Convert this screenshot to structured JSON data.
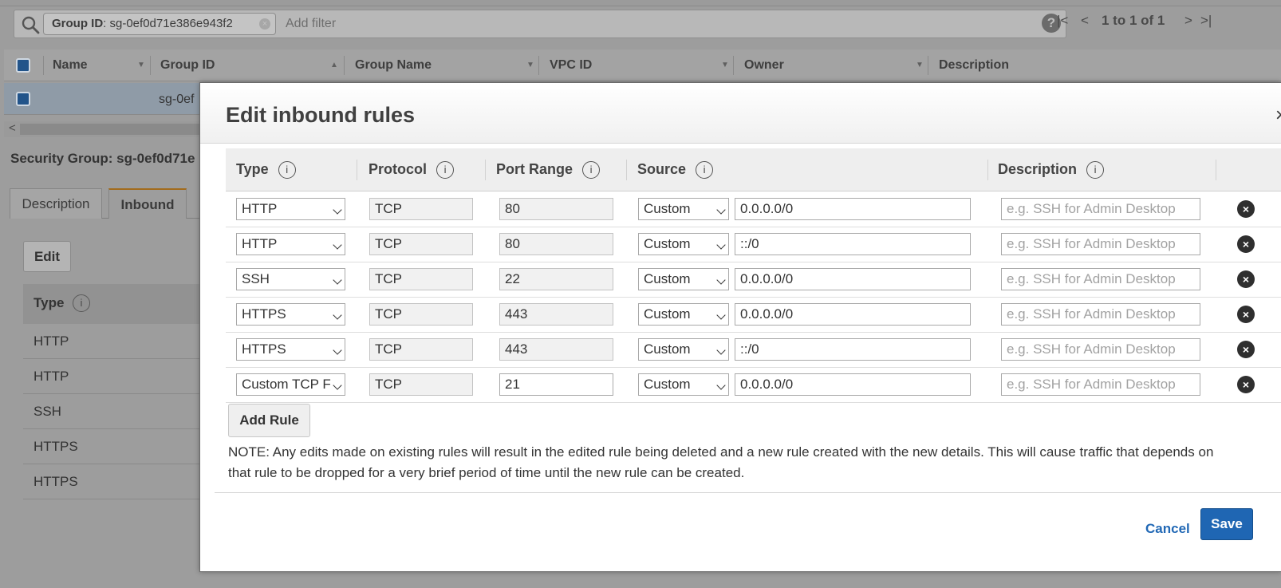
{
  "filter": {
    "chip_key": "Group ID",
    "chip_value": ": sg-0ef0d71e386e943f2",
    "placeholder": "Add filter",
    "help_glyph": "?",
    "pagination": "1 to 1 of 1",
    "first_glyph": "|<",
    "prev_glyph": "<",
    "next_glyph": ">",
    "last_glyph": ">|"
  },
  "grid": {
    "columns": [
      "Name",
      "Group ID",
      "Group Name",
      "VPC ID",
      "Owner",
      "Description"
    ],
    "row_group_id": "sg-0ef",
    "scroll_left": "<"
  },
  "detail": {
    "title": "Security Group: sg-0ef0d71e",
    "tabs": [
      "Description",
      "Inbound"
    ],
    "edit_label": "Edit",
    "type_header": "Type",
    "info_glyph": "i",
    "rows": [
      "HTTP",
      "HTTP",
      "SSH",
      "HTTPS",
      "HTTPS"
    ]
  },
  "modal": {
    "title": "Edit inbound rules",
    "close_glyph": "×",
    "headers": {
      "type": "Type",
      "protocol": "Protocol",
      "port_range": "Port Range",
      "source": "Source",
      "description": "Description",
      "info_glyph": "i"
    },
    "rules": [
      {
        "type": "HTTP",
        "protocol": "TCP",
        "port": "80",
        "source_type": "Custom",
        "cidr": "0.0.0.0/0",
        "desc_placeholder": "e.g. SSH for Admin Desktop"
      },
      {
        "type": "HTTP",
        "protocol": "TCP",
        "port": "80",
        "source_type": "Custom",
        "cidr": "::/0",
        "desc_placeholder": "e.g. SSH for Admin Desktop"
      },
      {
        "type": "SSH",
        "protocol": "TCP",
        "port": "22",
        "source_type": "Custom",
        "cidr": "0.0.0.0/0",
        "desc_placeholder": "e.g. SSH for Admin Desktop"
      },
      {
        "type": "HTTPS",
        "protocol": "TCP",
        "port": "443",
        "source_type": "Custom",
        "cidr": "0.0.0.0/0",
        "desc_placeholder": "e.g. SSH for Admin Desktop"
      },
      {
        "type": "HTTPS",
        "protocol": "TCP",
        "port": "443",
        "source_type": "Custom",
        "cidr": "::/0",
        "desc_placeholder": "e.g. SSH for Admin Desktop"
      },
      {
        "type": "Custom TCP F",
        "protocol": "TCP",
        "port": "21",
        "source_type": "Custom",
        "cidr": "0.0.0.0/0",
        "desc_placeholder": "e.g. SSH for Admin Desktop"
      }
    ],
    "remove_glyph": "×",
    "add_rule_label": "Add Rule",
    "note": "NOTE: Any edits made on existing rules will result in the edited rule being deleted and a new rule created with the new details. This will cause traffic that depends on that rule to be dropped for a very brief period of time until the new rule can be created.",
    "cancel_label": "Cancel",
    "save_label": "Save"
  },
  "colors": {
    "primary_button": "#1f66b3",
    "link": "#2168b5",
    "active_tab_accent": "#a26b1c",
    "overlay_background": "#9d9d9d"
  },
  "icons": [
    "search-icon",
    "clear-filter-icon",
    "help-icon",
    "first-page-icon",
    "prev-page-icon",
    "next-page-icon",
    "last-page-icon",
    "info-icon",
    "close-icon",
    "remove-rule-icon",
    "chevron-down-icon"
  ]
}
